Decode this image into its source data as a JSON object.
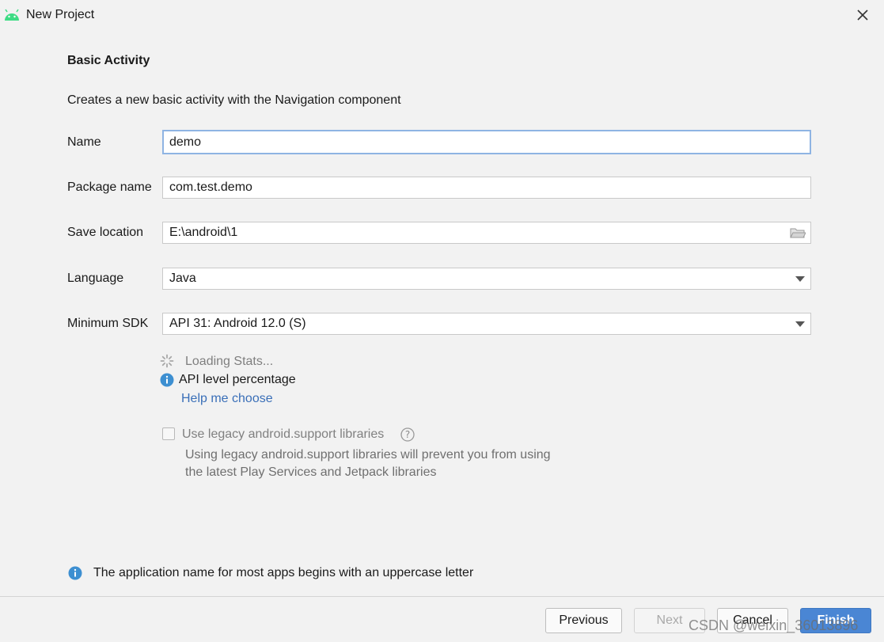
{
  "window": {
    "title": "New Project",
    "app_icon": "android-icon",
    "close_icon": "close-icon"
  },
  "header": {
    "heading": "Basic Activity",
    "description": "Creates a new basic activity with the Navigation component"
  },
  "form": {
    "name": {
      "label": "Name",
      "value": "demo"
    },
    "package": {
      "label": "Package name",
      "value": "com.test.demo"
    },
    "save_location": {
      "label": "Save location",
      "value": "E:\\android\\1",
      "icon": "folder-icon"
    },
    "language": {
      "label": "Language",
      "value": "Java"
    },
    "min_sdk": {
      "label": "Minimum SDK",
      "value": "API 31: Android 12.0 (S)"
    }
  },
  "stats": {
    "loading_text": "Loading Stats...",
    "api_text": "API level percentage",
    "help_link": "Help me choose"
  },
  "legacy": {
    "checked": false,
    "label": "Use legacy android.support libraries",
    "desc_line1": "Using legacy android.support libraries will prevent you from using",
    "desc_line2": "the latest Play Services and Jetpack libraries"
  },
  "hint": {
    "text": "The application name for most apps begins with an uppercase letter"
  },
  "buttons": {
    "previous": "Previous",
    "next": "Next",
    "cancel": "Cancel",
    "finish": "Finish"
  },
  "watermark": "CSDN @weixin_36013896",
  "colors": {
    "accent": "#4a86d4",
    "link": "#3a6fb8",
    "info_blue": "#3d8fd1",
    "android_green": "#3ddc84",
    "focus_border": "#8fb4e3"
  }
}
